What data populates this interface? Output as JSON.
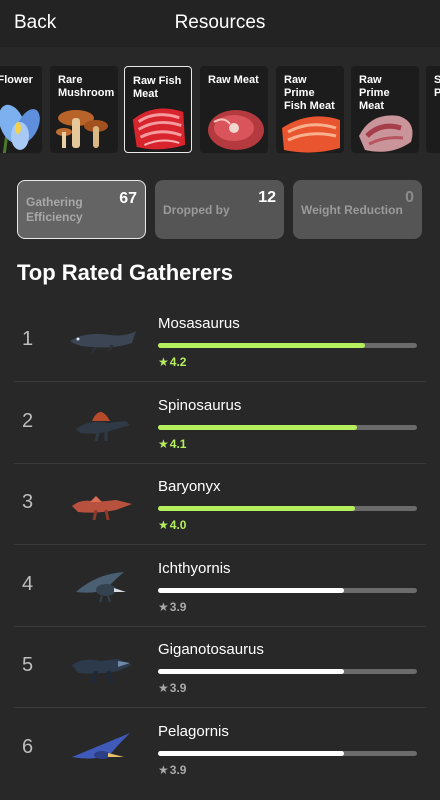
{
  "header": {
    "back_label": "Back",
    "title": "Resources"
  },
  "resources": [
    {
      "label": "Rare Flower",
      "icon": "flower-icon",
      "selected": false
    },
    {
      "label": "Rare Mushroom",
      "icon": "mushroom-icon",
      "selected": false
    },
    {
      "label": "Raw Fish Meat",
      "icon": "fish-meat-icon",
      "selected": true
    },
    {
      "label": "Raw Meat",
      "icon": "meat-icon",
      "selected": false
    },
    {
      "label": "Raw Prime Fish Meat",
      "icon": "prime-fish-meat-icon",
      "selected": false
    },
    {
      "label": "Raw Prime Meat",
      "icon": "prime-meat-icon",
      "selected": false
    },
    {
      "label": "S P",
      "icon": "next-resource-icon",
      "selected": false
    }
  ],
  "stats": [
    {
      "label": "Gathering Efficiency",
      "count": "67",
      "active": true
    },
    {
      "label": "Dropped by",
      "count": "12",
      "active": false
    },
    {
      "label": "Weight Reduction",
      "count": "0",
      "active": false
    }
  ],
  "section_title": "Top Rated Gatherers",
  "gatherers": [
    {
      "rank": "1",
      "name": "Mosasaurus",
      "rating": "4.2",
      "level": 0.8,
      "top": true,
      "icon": "mosasaurus-icon"
    },
    {
      "rank": "2",
      "name": "Spinosaurus",
      "rating": "4.1",
      "level": 0.77,
      "top": true,
      "icon": "spinosaurus-icon"
    },
    {
      "rank": "3",
      "name": "Baryonyx",
      "rating": "4.0",
      "level": 0.76,
      "top": true,
      "icon": "baryonyx-icon"
    },
    {
      "rank": "4",
      "name": "Ichthyornis",
      "rating": "3.9",
      "level": 0.72,
      "top": false,
      "icon": "ichthyornis-icon"
    },
    {
      "rank": "5",
      "name": "Giganotosaurus",
      "rating": "3.9",
      "level": 0.72,
      "top": false,
      "icon": "giganotosaurus-icon"
    },
    {
      "rank": "6",
      "name": "Pelagornis",
      "rating": "3.9",
      "level": 0.72,
      "top": false,
      "icon": "pelagornis-icon"
    }
  ],
  "colors": {
    "accent_green": "#b6ef5e",
    "bar_white": "#ffffff",
    "rating_gray": "#a9a9a9",
    "background": "#282828"
  }
}
